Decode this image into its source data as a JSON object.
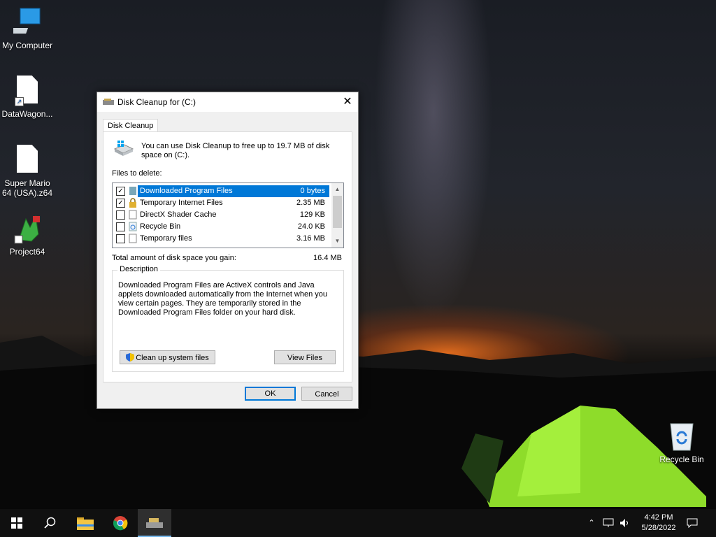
{
  "desktop": {
    "icons": [
      {
        "label": "My Computer"
      },
      {
        "label": "DataWagon..."
      },
      {
        "label": "Super Mario 64 (USA).z64"
      },
      {
        "label": "Project64"
      }
    ],
    "recycle_bin": {
      "label": "Recycle Bin"
    }
  },
  "dialog": {
    "title": "Disk Cleanup for  (C:)",
    "close_glyph": "✕",
    "tab": "Disk Cleanup",
    "intro": "You can use Disk Cleanup to free up to 19.7 MB of disk space on  (C:).",
    "files_label": "Files to delete:",
    "files": [
      {
        "name": "Downloaded Program Files",
        "size": "0 bytes",
        "checked": true,
        "selected": true
      },
      {
        "name": "Temporary Internet Files",
        "size": "2.35 MB",
        "checked": true,
        "selected": false
      },
      {
        "name": "DirectX Shader Cache",
        "size": "129 KB",
        "checked": false,
        "selected": false
      },
      {
        "name": "Recycle Bin",
        "size": "24.0 KB",
        "checked": false,
        "selected": false
      },
      {
        "name": "Temporary files",
        "size": "3.16 MB",
        "checked": false,
        "selected": false
      }
    ],
    "check_glyph": "✓",
    "total_label": "Total amount of disk space you gain:",
    "total_value": "16.4 MB",
    "description_title": "Description",
    "description_text": "Downloaded Program Files are ActiveX controls and Java applets downloaded automatically from the Internet when you view certain pages. They are temporarily stored in the Downloaded Program Files folder on your hard disk.",
    "cleanup_system_button": "Clean up system files",
    "view_files_button": "View Files",
    "ok_button": "OK",
    "cancel_button": "Cancel"
  },
  "taskbar": {
    "time": "4:42 PM",
    "date": "5/28/2022"
  },
  "colors": {
    "selection": "#0078d7",
    "taskbar": "#101010"
  }
}
